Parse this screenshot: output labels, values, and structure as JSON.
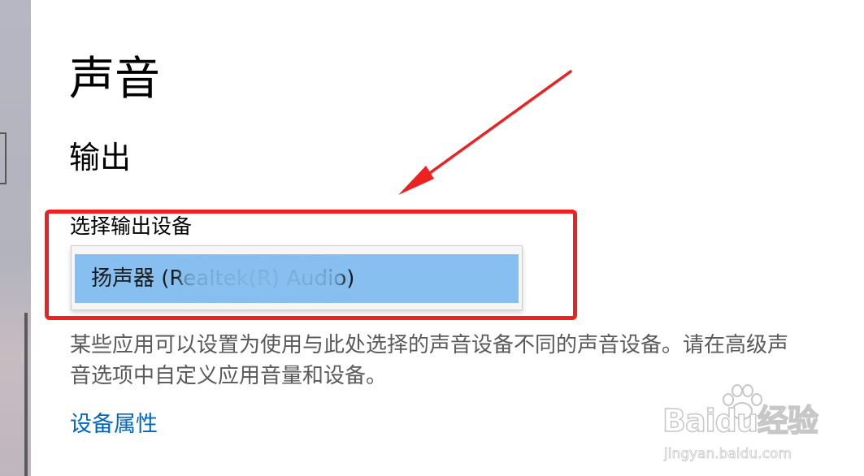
{
  "page": {
    "title": "声音",
    "section_title": "输出"
  },
  "output": {
    "label": "选择输出设备",
    "selected_device": "扬声器 (Realtek(R) Audio)",
    "description": "某些应用可以设置为使用与此处选择的声音设备不同的声音设备。请在高级声音选项中自定义应用音量和设备。",
    "device_properties_link": "设备属性"
  },
  "annotation": {
    "highlight_color": "#ee2020"
  },
  "watermark": {
    "logo_text": "Baidu经验",
    "url": "jingyan.baidu.com"
  },
  "colors": {
    "accent": "#0067c0",
    "selected_option": "#86bff0",
    "left_nav": "#b7b7c3"
  }
}
